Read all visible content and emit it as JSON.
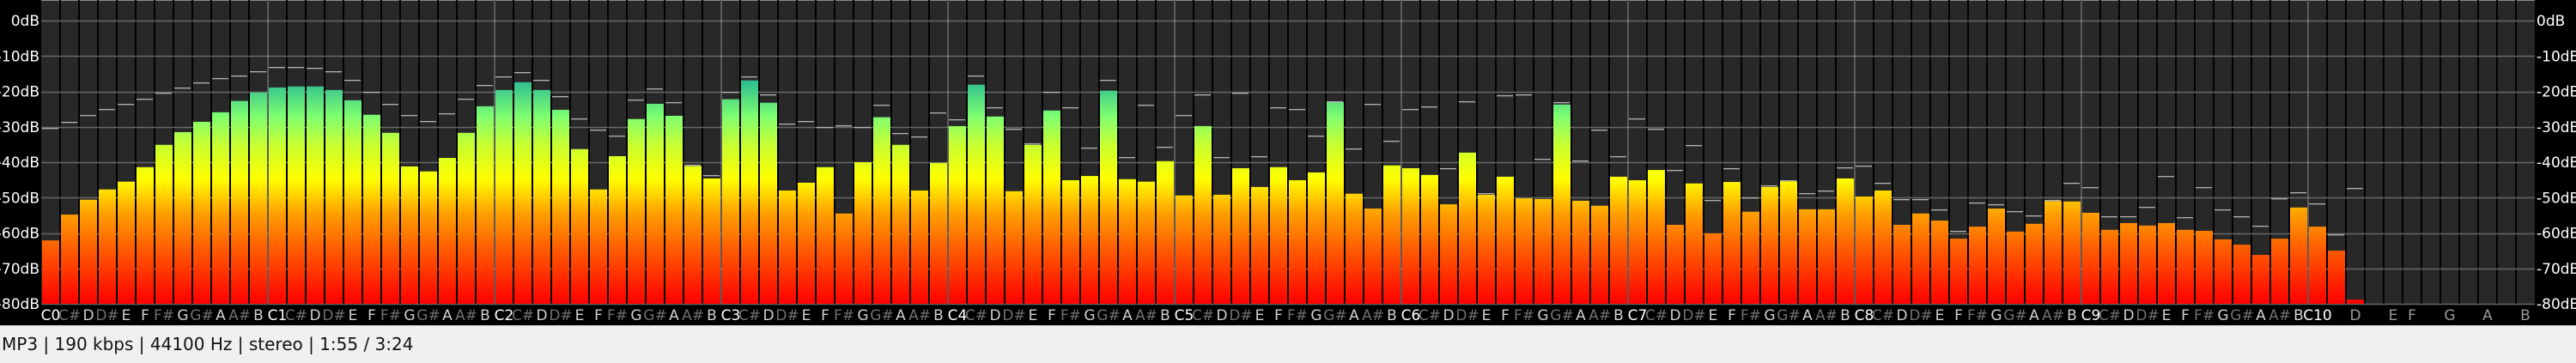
{
  "chart_data": {
    "type": "bar",
    "title": "",
    "xlabel": "",
    "ylabel": "dB",
    "ylim": [
      -80,
      0
    ],
    "y_ticks": [
      "0dB",
      "-10dB",
      "-20dB",
      "-30dB",
      "-40dB",
      "-50dB",
      "-60dB",
      "-70dB",
      "-80dB"
    ],
    "y_tick_values": [
      0,
      -10,
      -20,
      -30,
      -40,
      -50,
      -60,
      -70,
      -80
    ],
    "grid": true,
    "x_labels": [
      "C0",
      "C#",
      "D",
      "D#",
      "E",
      "F",
      "F#",
      "G",
      "G#",
      "A",
      "A#",
      "B",
      "C1",
      "C#",
      "D",
      "D#",
      "E",
      "F",
      "F#",
      "G",
      "G#",
      "A",
      "A#",
      "B",
      "C2",
      "C#",
      "D",
      "D#",
      "E",
      "F",
      "F#",
      "G",
      "G#",
      "A",
      "A#",
      "B",
      "C3",
      "C#",
      "D",
      "D#",
      "E",
      "F",
      "F#",
      "G",
      "G#",
      "A",
      "A#",
      "B",
      "C4",
      "C#",
      "D",
      "D#",
      "E",
      "F",
      "F#",
      "G",
      "G#",
      "A",
      "A#",
      "B",
      "C5",
      "C#",
      "D",
      "D#",
      "E",
      "F",
      "F#",
      "G",
      "G#",
      "A",
      "A#",
      "B",
      "C6",
      "C#",
      "D",
      "D#",
      "E",
      "F",
      "F#",
      "G",
      "G#",
      "A",
      "A#",
      "B",
      "C7",
      "C#",
      "D",
      "D#",
      "E",
      "F",
      "F#",
      "G",
      "G#",
      "A",
      "A#",
      "B",
      "C8",
      "C#",
      "D",
      "D#",
      "E",
      "F",
      "F#",
      "G",
      "G#",
      "A",
      "A#",
      "B",
      "C9",
      "C#",
      "D",
      "D#",
      "E",
      "F",
      "F#",
      "G",
      "G#",
      "A",
      "A#",
      "B",
      "C10",
      "",
      "D",
      "",
      "E",
      "F",
      "",
      "G",
      "",
      "A",
      "",
      "B"
    ],
    "series": [
      {
        "name": "level",
        "values": [
          -62.1,
          -54.8,
          -50.6,
          -47.7,
          -45.5,
          -41.4,
          -35.1,
          -31.5,
          -28.6,
          -25.9,
          -22.7,
          -20.3,
          -18.9,
          -18.6,
          -18.6,
          -19.6,
          -22.5,
          -26.6,
          -31.7,
          -41.2,
          -42.6,
          -38.8,
          -31.7,
          -24.2,
          -19.6,
          -17.4,
          -19.6,
          -25.2,
          -36.3,
          -47.7,
          -38.3,
          -27.8,
          -23.5,
          -26.9,
          -41.1,
          -44.6,
          -22.2,
          -16.9,
          -23.2,
          -48.0,
          -45.8,
          -41.4,
          -54.5,
          -40.0,
          -27.3,
          -35.1,
          -48.0,
          -40.2,
          -29.8,
          -18.1,
          -27.1,
          -48.2,
          -35.1,
          -25.4,
          -45.1,
          -43.9,
          -19.8,
          -44.8,
          -45.5,
          -39.7,
          -49.4,
          -29.8,
          -49.2,
          -41.7,
          -47.0,
          -41.4,
          -45.1,
          -42.9,
          -23.0,
          -48.9,
          -53.1,
          -40.9,
          -41.7,
          -43.6,
          -51.9,
          -37.3,
          -49.2,
          -44.1,
          -50.2,
          -50.4,
          -23.7,
          -50.9,
          -52.3,
          -44.1,
          -45.1,
          -42.2,
          -57.7,
          -46.0,
          -60.1,
          -45.6,
          -54.0,
          -47.0,
          -45.4,
          -53.3,
          -53.3,
          -44.6,
          -49.7,
          -48.0,
          -57.7,
          -54.5,
          -56.5,
          -61.6,
          -58.2,
          -53.1,
          -59.6,
          -57.4,
          -51.0,
          -51.1,
          -54.3,
          -59.1,
          -57.2,
          -57.9,
          -57.2,
          -59.1,
          -59.4,
          -61.8,
          -63.3,
          -66.2,
          -61.6,
          -52.8,
          -58.2,
          -65.0,
          -78.8,
          null,
          null,
          null,
          null,
          null,
          null,
          null,
          null,
          null
        ]
      },
      {
        "name": "peak",
        "values": [
          -30.6,
          -28.9,
          -26.9,
          -25.2,
          -23.8,
          -22.3,
          -20.6,
          -19.2,
          -17.7,
          -16.5,
          -15.8,
          -14.6,
          -13.3,
          -13.3,
          -13.6,
          -14.6,
          -17.0,
          -20.4,
          -23.8,
          -26.9,
          -28.6,
          -26.5,
          -22.3,
          -18.4,
          -16.0,
          -14.8,
          -17.0,
          -21.6,
          -27.9,
          -31.1,
          -32.8,
          -22.6,
          -19.4,
          -23.3,
          -40.9,
          -43.9,
          -20.4,
          -16.0,
          -21.1,
          -29.4,
          -28.6,
          -30.3,
          -29.9,
          -30.3,
          -24.0,
          -32.0,
          -33.0,
          -26.2,
          -28.2,
          -15.8,
          -24.8,
          -30.8,
          -35.0,
          -20.4,
          -24.8,
          -36.2,
          -17.0,
          -38.8,
          -24.0,
          -35.9,
          -26.9,
          -21.1,
          -38.8,
          -20.6,
          -38.6,
          -24.8,
          -25.2,
          -32.8,
          -23.0,
          -36.4,
          -23.8,
          -34.2,
          -25.2,
          -24.5,
          -42.0,
          -23.1,
          -49.0,
          -21.4,
          -21.1,
          -39.3,
          -23.3,
          -39.8,
          -31.1,
          -38.6,
          -27.9,
          -30.8,
          -42.5,
          -35.4,
          -51.0,
          -42.0,
          -50.2,
          -46.8,
          -45.4,
          -49.0,
          -48.3,
          -41.7,
          -41.3,
          -46.1,
          -50.7,
          -50.7,
          -53.6,
          -59.7,
          -51.7,
          -52.2,
          -54.1,
          -55.3,
          -51.0,
          -46.1,
          -47.3,
          -55.6,
          -55.6,
          -52.9,
          -44.2,
          -55.8,
          -47.3,
          -53.6,
          -55.6,
          -58.3,
          -50.5,
          -48.8,
          -51.9,
          -60.7,
          -47.6,
          null,
          null,
          null,
          null,
          null,
          null,
          null,
          null,
          null
        ]
      }
    ],
    "colors": {
      "plot_bg": "#282828",
      "divider": "#000000",
      "grid": "#666666",
      "octave_line": "#9a9a9a",
      "peak_marker": "#b4b4b4",
      "label_c": "#ffffff",
      "label_natural": "#d0d0d0",
      "label_sharp": "#707070",
      "gradient": [
        "#ff0000",
        "#ff5a00",
        "#ffa000",
        "#ffff00",
        "#c8ff30",
        "#80ff70",
        "#30c090"
      ]
    }
  },
  "status": {
    "text": "MP3 | 190 kbps | 44100 Hz | stereo | 1:55 / 3:24"
  }
}
